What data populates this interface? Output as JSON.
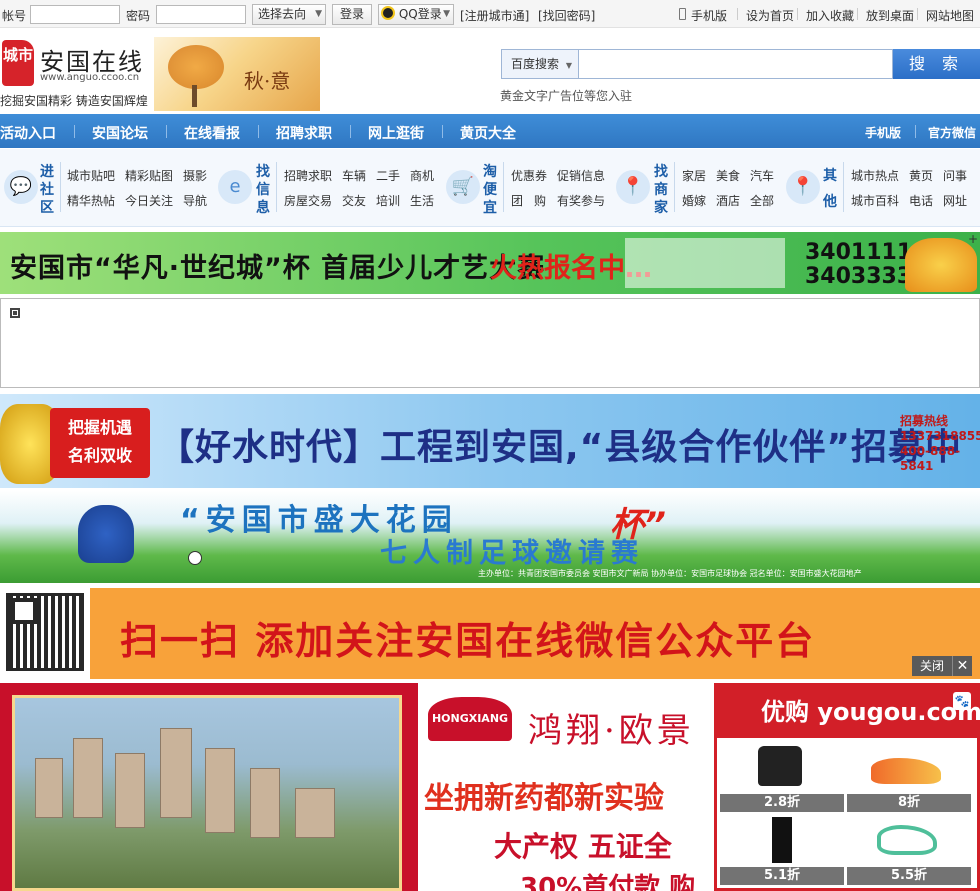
{
  "topbar": {
    "account_label": "帐号",
    "password_label": "密码",
    "goto_select": "选择去向",
    "login_button": "登录",
    "qq_login": "QQ登录",
    "register": "[注册城市通]",
    "find_password": "[找回密码]",
    "links": [
      "手机版",
      "设为首页",
      "加入收藏",
      "放到桌面",
      "网站地图"
    ]
  },
  "header": {
    "logo_mark": "城市",
    "site_name": "安国在线",
    "site_url": "www.anguo.ccoo.cn",
    "slogan": "挖掘安国精彩 铸造安国辉煌",
    "autumn_text": "秋·意",
    "search_engine": "百度搜索",
    "search_value": "",
    "search_button": "搜 索",
    "ad_text": "黄金文字广告位等您入驻"
  },
  "nav": {
    "items": [
      "活动入口",
      "安国论坛",
      "在线看报",
      "招聘求职",
      "网上逛街",
      "黄页大全"
    ],
    "right": [
      "手机版",
      "官方微信"
    ]
  },
  "categories": [
    {
      "title": "进社区",
      "links": [
        "城市贴吧",
        "精彩贴图",
        "摄影",
        "精华热帖",
        "今日关注",
        "导航"
      ]
    },
    {
      "title": "找信息",
      "links": [
        "招聘求职",
        "车辆",
        "二手",
        "商机",
        "房屋交易",
        "交友",
        "培训",
        "生活"
      ]
    },
    {
      "title": "淘便宜",
      "links": [
        "优惠券",
        "促销信息",
        "团",
        "购",
        "有奖参与"
      ]
    },
    {
      "title": "找商家",
      "links": [
        "家居",
        "美食",
        "汽车",
        "婚嫁",
        "酒店",
        "全部"
      ]
    },
    {
      "title": "其他",
      "links": [
        "城市热点",
        "黄页",
        "问事",
        "城市百科",
        "电话",
        "网址"
      ]
    }
  ],
  "banners": {
    "b1_text": "安国市“华凡·世纪城”杯  首届少儿才艺大赛",
    "b1_hot": "火热报名中…",
    "b1_phone1": "3401111",
    "b1_phone2": "3403333",
    "b2_badge1": "把握机遇",
    "b2_badge2": "名利双收",
    "b2_main": "【好水时代】工程到安国,“县级合作伙伴”招募中",
    "b2_hotline": "招募热线",
    "b2_phone1": "13373188551",
    "b2_phone2": "400-888-5841",
    "b3_title": "“安国市盛大花园",
    "b3_cup": "杯”",
    "b3_sub": "七人制足球邀请赛",
    "b3_small": "主办单位：共青团安国市委员会    安国市文广新局    协办单位：安国市足球协会    冠名单位：安国市盛大花园地产",
    "b4_text": "扫一扫  添加关注安国在线微信公众平台",
    "close_label": "关闭",
    "b5_logo": "HONGXIANG",
    "b5_h1": "鸿翔·欧景",
    "b5_h2": "坐拥新药都新实验",
    "b5_h3": "大产权 五证全",
    "b5_h4": "30%首付款 购"
  },
  "yougou": {
    "brand": "优购 yougou.com",
    "products": [
      {
        "name": "handbag",
        "discount": "2.8折"
      },
      {
        "name": "sneaker",
        "discount": "8折"
      },
      {
        "name": "pants",
        "discount": "5.1折"
      },
      {
        "name": "sandal",
        "discount": "5.5折"
      }
    ]
  },
  "colors": {
    "nav_blue": "#3a86d2",
    "brand_red": "#d6232a",
    "yougou_red": "#d21f28"
  }
}
